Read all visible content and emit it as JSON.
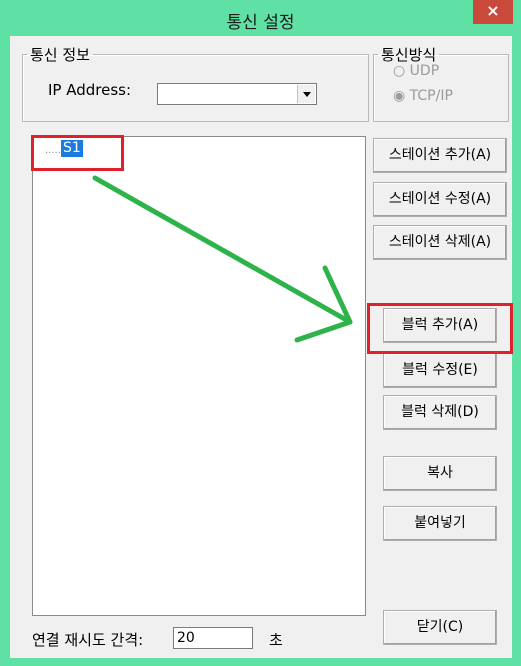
{
  "window": {
    "title": "통신 설정",
    "close_glyph": "×"
  },
  "comm_info": {
    "legend": "통신 정보",
    "ip_label": "IP Address:",
    "ip_value": ""
  },
  "comm_method": {
    "legend": "통신방식",
    "options": [
      "UDP",
      "TCP/IP"
    ],
    "selected": "TCP/IP"
  },
  "tree": {
    "nodes": [
      {
        "label": "S1",
        "selected": true
      }
    ]
  },
  "buttons": {
    "add_station": "스테이션 추가(A)",
    "edit_station": "스테이션 수정(A)",
    "delete_station": "스테이션 삭제(A)",
    "add_block": "블럭 추가(A)",
    "edit_block": "블럭 수정(E)",
    "delete_block": "블럭 삭제(D)",
    "copy": "복사",
    "paste": "붙여넣기",
    "close": "닫기(C)"
  },
  "retry": {
    "label": "연결 재시도 간격:",
    "value": "20",
    "unit": "초"
  },
  "colors": {
    "accent_title": "#5fe0a5",
    "annotation_red": "#e0202a",
    "annotation_green": "#2db34a",
    "selection": "#1a7be0"
  }
}
